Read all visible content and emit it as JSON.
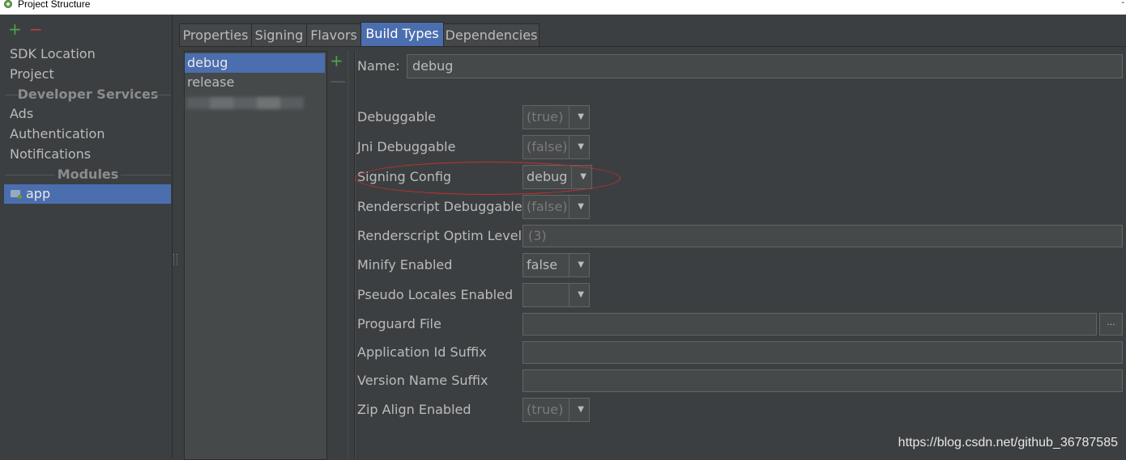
{
  "window": {
    "title": "Project Structure",
    "icon": "android-studio-icon",
    "corner_glyph": "-"
  },
  "left_pane": {
    "add_glyph": "+",
    "remove_glyph": "−",
    "items": [
      "SDK Location",
      "Project"
    ],
    "section_developer_services": "Developer Services",
    "developer_services": [
      "Ads",
      "Authentication",
      "Notifications"
    ],
    "section_modules": "Modules",
    "modules": [
      "app"
    ],
    "selected_module": "app"
  },
  "tabs": [
    "Properties",
    "Signing",
    "Flavors",
    "Build Types",
    "Dependencies"
  ],
  "active_tab": "Build Types",
  "build_types": {
    "items": [
      "debug",
      "release"
    ],
    "selected": "debug",
    "add_glyph": "+",
    "remove_glyph": "—"
  },
  "form": {
    "name_label": "Name:",
    "name_value": "debug",
    "debuggable_label": "Debuggable",
    "debuggable_value": "(true)",
    "jni_label": "Jni Debuggable",
    "jni_value": "(false)",
    "signing_label": "Signing Config",
    "signing_value": "debug",
    "renderscript_debuggable_label": "Renderscript Debuggable",
    "renderscript_debuggable_value": "(false)",
    "renderscript_optim_label": "Renderscript Optim Level",
    "renderscript_optim_value": "(3)",
    "minify_label": "Minify Enabled",
    "minify_value": "false",
    "pseudo_label": "Pseudo Locales Enabled",
    "pseudo_value": "",
    "proguard_label": "Proguard File",
    "proguard_value": "",
    "browse_label": "...",
    "app_id_suffix_label": "Application Id Suffix",
    "app_id_suffix_value": "",
    "version_name_suffix_label": "Version Name Suffix",
    "version_name_suffix_value": "",
    "zip_align_label": "Zip Align Enabled",
    "zip_align_value": "(true)"
  },
  "combo_arrow": "▼",
  "watermark": "https://blog.csdn.net/github_36787585",
  "colors": {
    "selection": "#4b6eaf",
    "background": "#3c3f41",
    "annotation": "#c8302c",
    "add": "#4ba64b",
    "remove": "#c73a3a"
  }
}
